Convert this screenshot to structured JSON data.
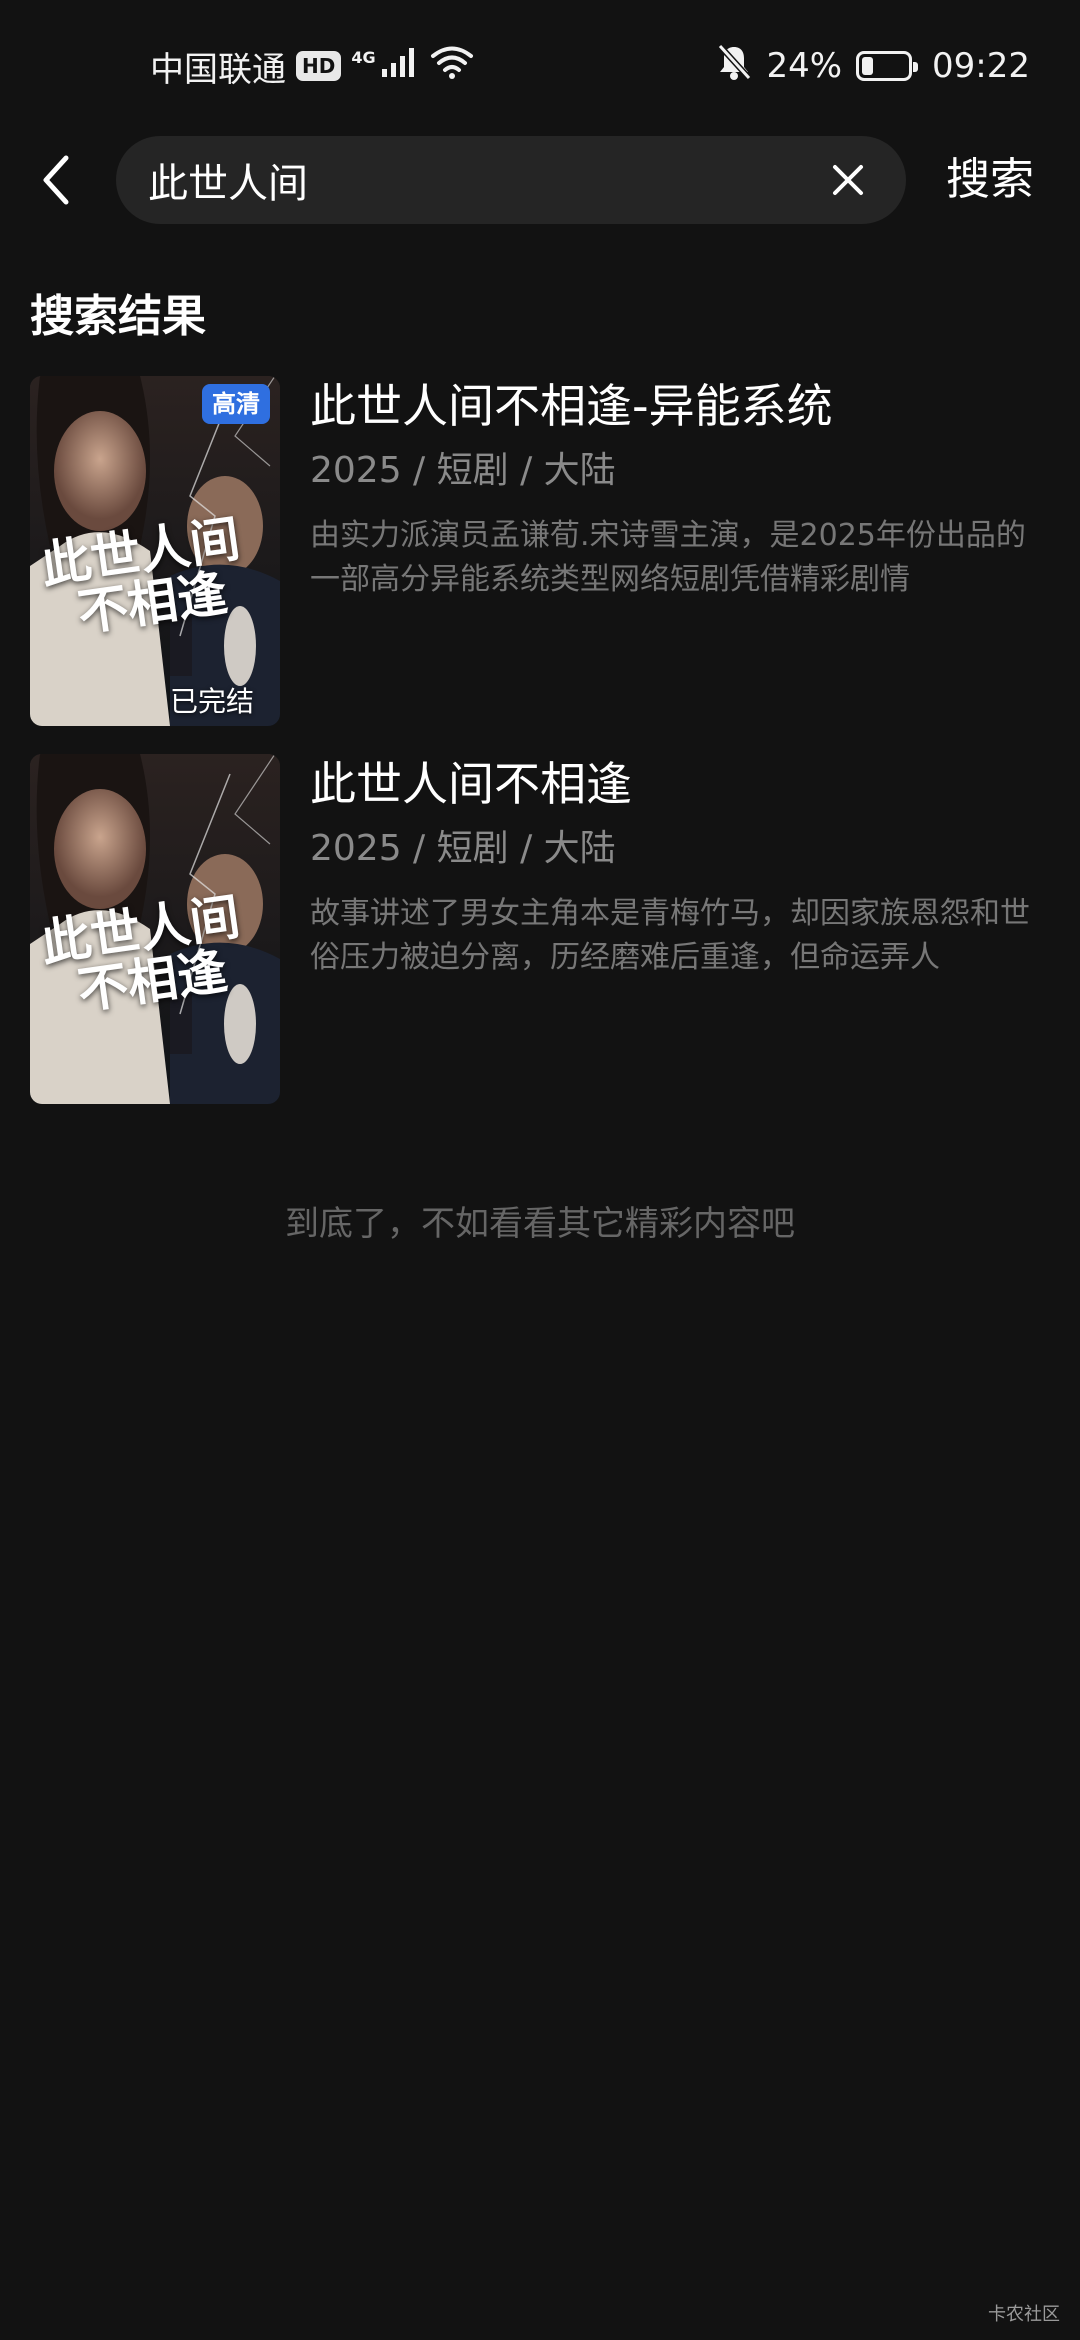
{
  "status_bar": {
    "carrier": "中国联通",
    "hd_badge": "HD",
    "network": "4G",
    "battery_percent": "24%",
    "battery_level": 0.24,
    "time": "09:22"
  },
  "search": {
    "query": "此世人间",
    "submit_label": "搜索"
  },
  "section_title": "搜索结果",
  "results": [
    {
      "title": "此世人间不相逢-异能系统",
      "meta": "2025 / 短剧 / 大陆",
      "description": "由实力派演员孟谦荀.宋诗雪主演，是2025年份出品的一部高分异能系统类型网络短剧凭借精彩剧情",
      "badge": "高清",
      "status": "已完结",
      "poster_title_line1": "此世人间",
      "poster_title_line2": "不相逢"
    },
    {
      "title": "此世人间不相逢",
      "meta": "2025 / 短剧 / 大陆",
      "description": "故事讲述了男女主角本是青梅竹马，却因家族恩怨和世俗压力被迫分离，历经磨难后重逢，但命运弄人",
      "poster_title_line1": "此世人间",
      "poster_title_line2": "不相逢"
    }
  ],
  "end_hint": "到底了，不如看看其它精彩内容吧",
  "watermark": "卡农社区",
  "colors": {
    "background": "#121212",
    "search_box": "#252525",
    "badge": "#2f6fe0",
    "meta_text": "#8a8a8a",
    "desc_text": "#777777"
  }
}
